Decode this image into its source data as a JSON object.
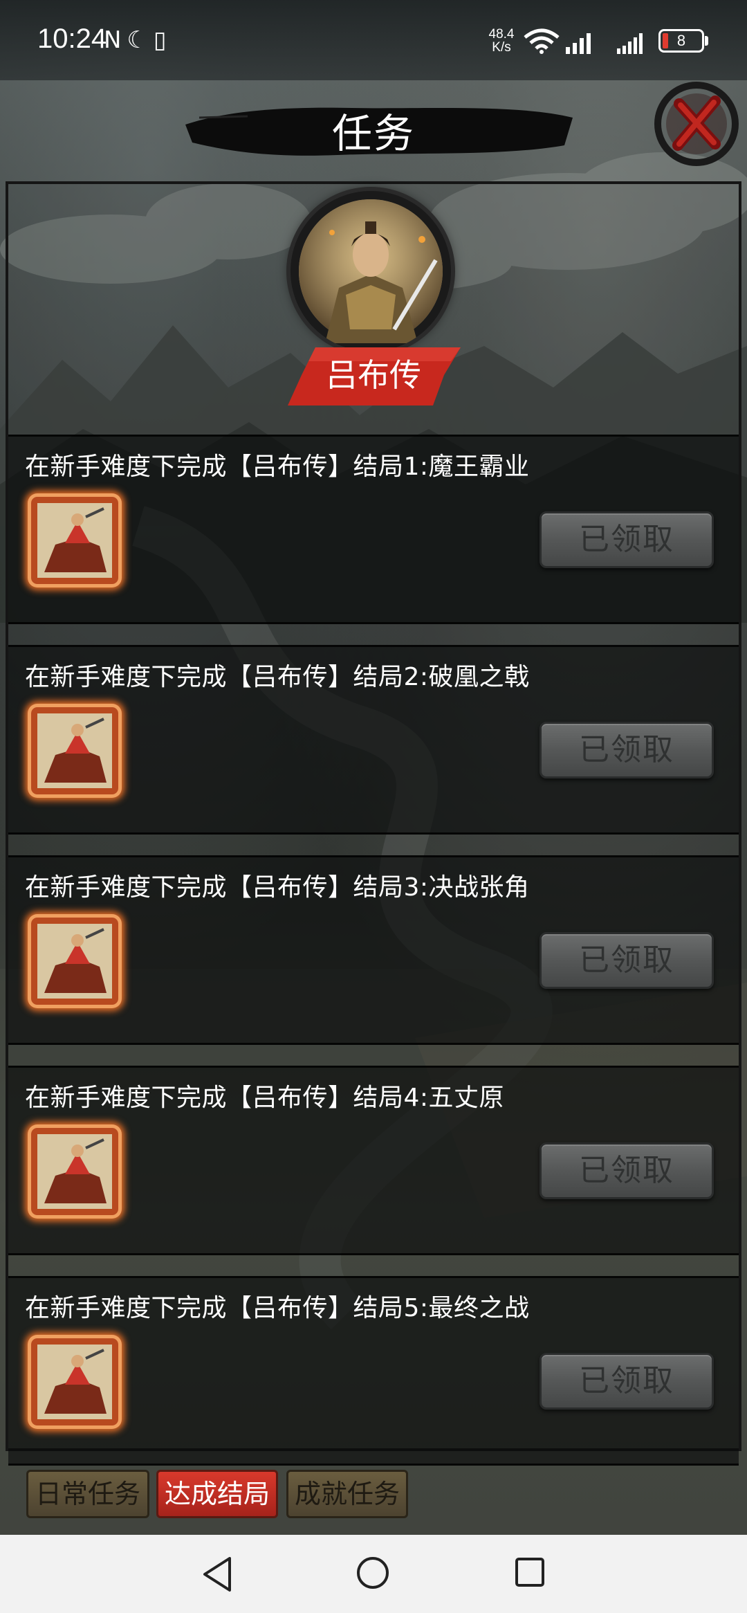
{
  "status_bar": {
    "time": "10:24",
    "left_icons": "N☾▯",
    "speed_value": "48.4",
    "speed_unit": "K/s",
    "battery": "8"
  },
  "header": {
    "title": "任务"
  },
  "hero": {
    "name": "吕布传"
  },
  "tasks": [
    {
      "text": "在新手难度下完成【吕布传】结局1:魔王霸业",
      "button": "已领取"
    },
    {
      "text": "在新手难度下完成【吕布传】结局2:破凰之戟",
      "button": "已领取"
    },
    {
      "text": "在新手难度下完成【吕布传】结局3:决战张角",
      "button": "已领取"
    },
    {
      "text": "在新手难度下完成【吕布传】结局4:五丈原",
      "button": "已领取"
    },
    {
      "text": "在新手难度下完成【吕布传】结局5:最终之战",
      "button": "已领取"
    }
  ],
  "tabs": [
    {
      "label": "日常任务",
      "active": false
    },
    {
      "label": "达成结局",
      "active": true
    },
    {
      "label": "成就任务",
      "active": false
    }
  ],
  "colors": {
    "active_tab": "#d8392c",
    "inactive_tab": "#6a5d3f",
    "claimed_button": "#5a5c5c",
    "reward_glow": "#ff7828",
    "battery_low": "#e03b30"
  },
  "icons": {
    "close": "close-brush-x-icon",
    "reward": "cavalry-general-icon",
    "nav_back": "triangle-back-icon",
    "nav_home": "circle-home-icon",
    "nav_recent": "square-recent-icon"
  }
}
